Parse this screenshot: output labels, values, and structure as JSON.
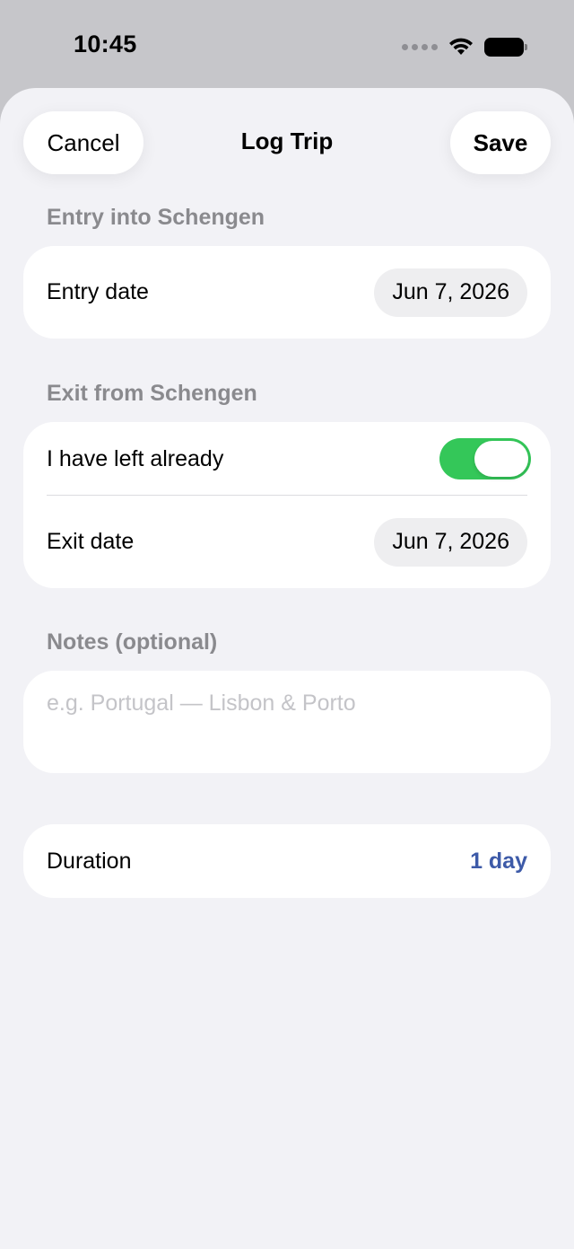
{
  "status_bar": {
    "time": "10:45",
    "icons": [
      "signal-dots-icon",
      "wifi-icon",
      "battery-icon"
    ]
  },
  "nav": {
    "cancel_label": "Cancel",
    "title": "Log Trip",
    "save_label": "Save"
  },
  "entry": {
    "header": "Entry into Schengen",
    "date_label": "Entry date",
    "date_value": "Jun 7, 2026"
  },
  "exit": {
    "header": "Exit from Schengen",
    "left_label": "I have left already",
    "left_toggle_on": true,
    "date_label": "Exit date",
    "date_value": "Jun 7, 2026"
  },
  "notes": {
    "header": "Notes (optional)",
    "value": "",
    "placeholder": "e.g. Portugal — Lisbon & Porto"
  },
  "duration": {
    "label": "Duration",
    "value": "1 day"
  },
  "colors": {
    "toggle_on": "#34c759",
    "accent": "#3d5aa8",
    "background": "#f2f2f6"
  }
}
